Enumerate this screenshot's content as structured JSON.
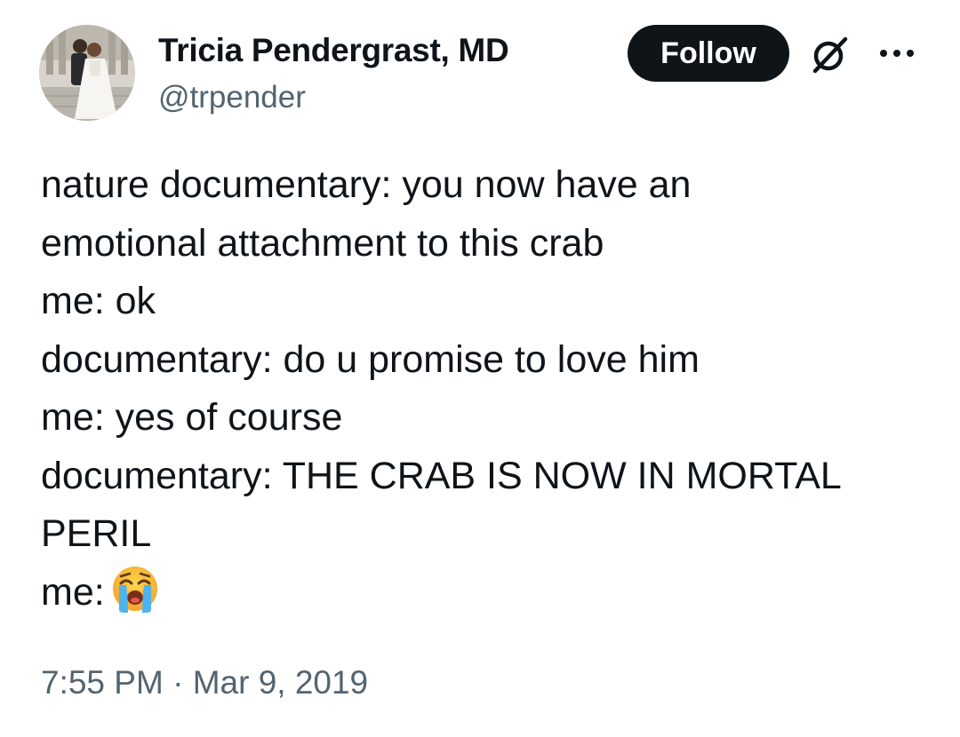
{
  "author": {
    "display_name": "Tricia Pendergrast, MD",
    "handle": "@trpender",
    "avatar": "avatar-photo"
  },
  "header": {
    "follow_label": "Follow",
    "grok_icon": "grok-icon",
    "more_icon": "more-options-icon"
  },
  "tweet": {
    "lines": [
      "nature documentary: you now have an",
      "emotional attachment to this crab",
      "me: ok",
      "documentary: do u promise to love him",
      "me: yes of course",
      "documentary: THE CRAB IS NOW IN MORTAL",
      "PERIL",
      "me:"
    ],
    "emoji": "loudly-crying-face-emoji"
  },
  "meta": {
    "time": "7:55 PM",
    "separator": "·",
    "date": "Mar 9, 2019"
  }
}
